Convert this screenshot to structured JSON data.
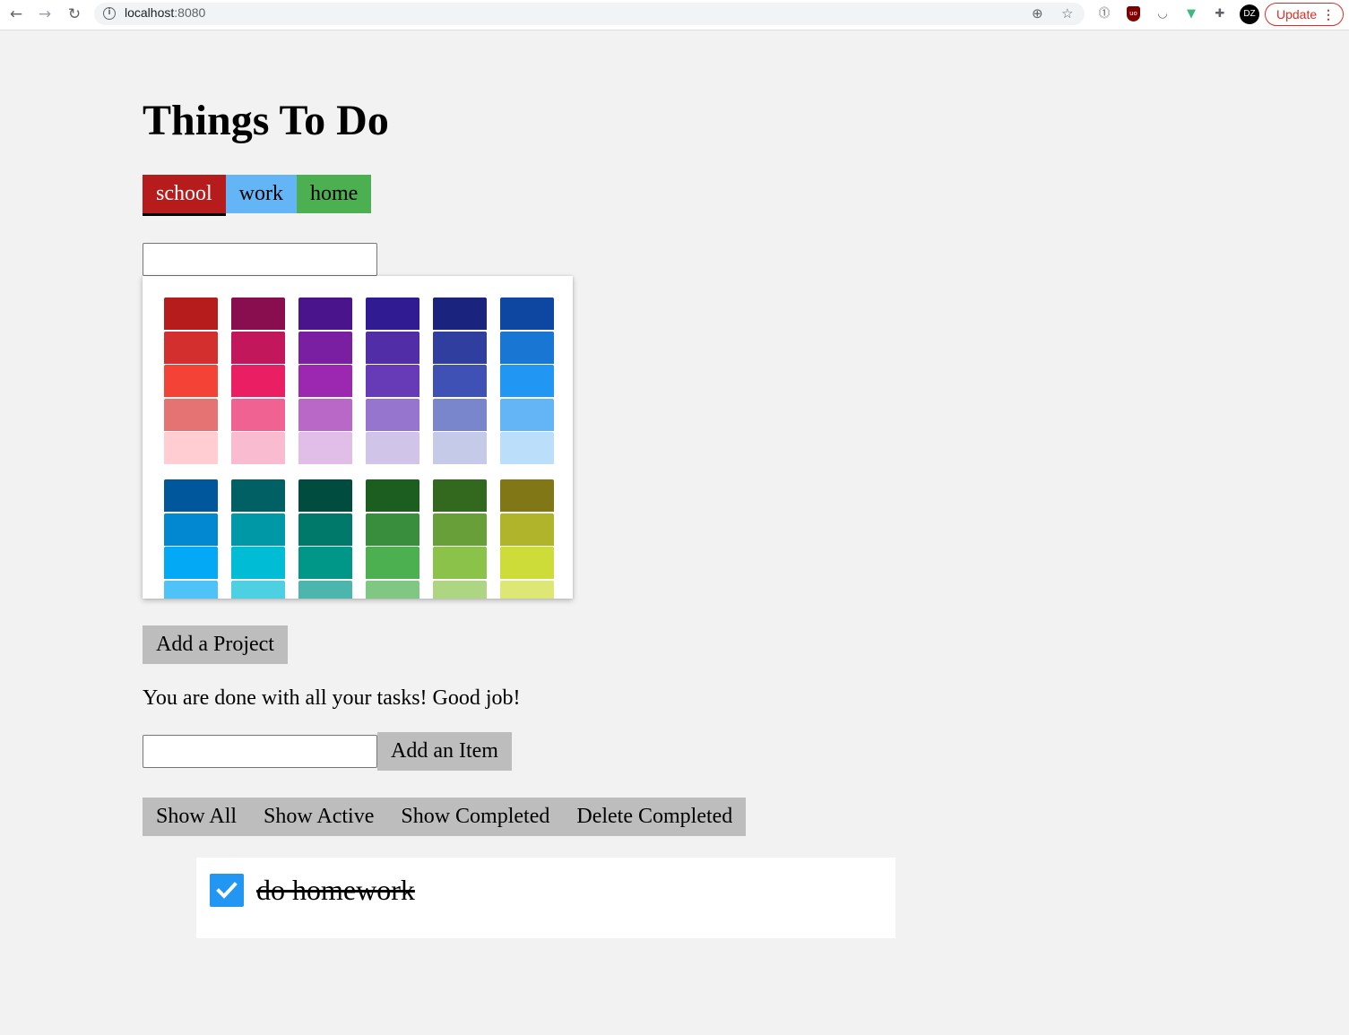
{
  "browser": {
    "url_host": "localhost",
    "url_port": ":8080",
    "update_label": "Update",
    "avatar_initials": "DZ",
    "ublock_text": "uo"
  },
  "app": {
    "title": "Things To Do",
    "projects": [
      {
        "label": "school",
        "color": "#b71c1c",
        "active": true
      },
      {
        "label": "work",
        "color": "#64b5f6",
        "active": false
      },
      {
        "label": "home",
        "color": "#4caf50",
        "active": false
      }
    ],
    "project_input_value": "",
    "palette": {
      "groups": [
        [
          [
            "#b71c1c",
            "#d32f2f",
            "#f44336",
            "#e57373",
            "#ffcdd2"
          ],
          [
            "#880e4f",
            "#c2185b",
            "#e91e63",
            "#f06292",
            "#f8bbd0"
          ],
          [
            "#4a148c",
            "#7b1fa2",
            "#9c27b0",
            "#ba68c8",
            "#e1bee7"
          ],
          [
            "#311b92",
            "#512da8",
            "#673ab7",
            "#9575cd",
            "#d1c4e9"
          ],
          [
            "#1a237e",
            "#303f9f",
            "#3f51b5",
            "#7986cb",
            "#c5cae9"
          ],
          [
            "#0d47a1",
            "#1976d2",
            "#2196f3",
            "#64b5f6",
            "#bbdefb"
          ]
        ],
        [
          [
            "#01579b",
            "#0288d1",
            "#03a9f4",
            "#4fc3f7"
          ],
          [
            "#006064",
            "#0097a7",
            "#00bcd4",
            "#4dd0e1"
          ],
          [
            "#004d40",
            "#00796b",
            "#009688",
            "#4db6ac"
          ],
          [
            "#1b5e20",
            "#388e3c",
            "#4caf50",
            "#81c784"
          ],
          [
            "#33691e",
            "#689f38",
            "#8bc34a",
            "#aed581"
          ],
          [
            "#827717",
            "#afb42b",
            "#cddc39",
            "#dce775"
          ]
        ]
      ]
    },
    "add_project_label": "Add a Project",
    "done_message": "You are done with all your tasks! Good job!",
    "item_input_value": "",
    "add_item_label": "Add an Item",
    "filters": [
      "Show All",
      "Show Active",
      "Show Completed",
      "Delete Completed"
    ],
    "tasks": [
      {
        "text": "do homework",
        "completed": true
      }
    ]
  }
}
